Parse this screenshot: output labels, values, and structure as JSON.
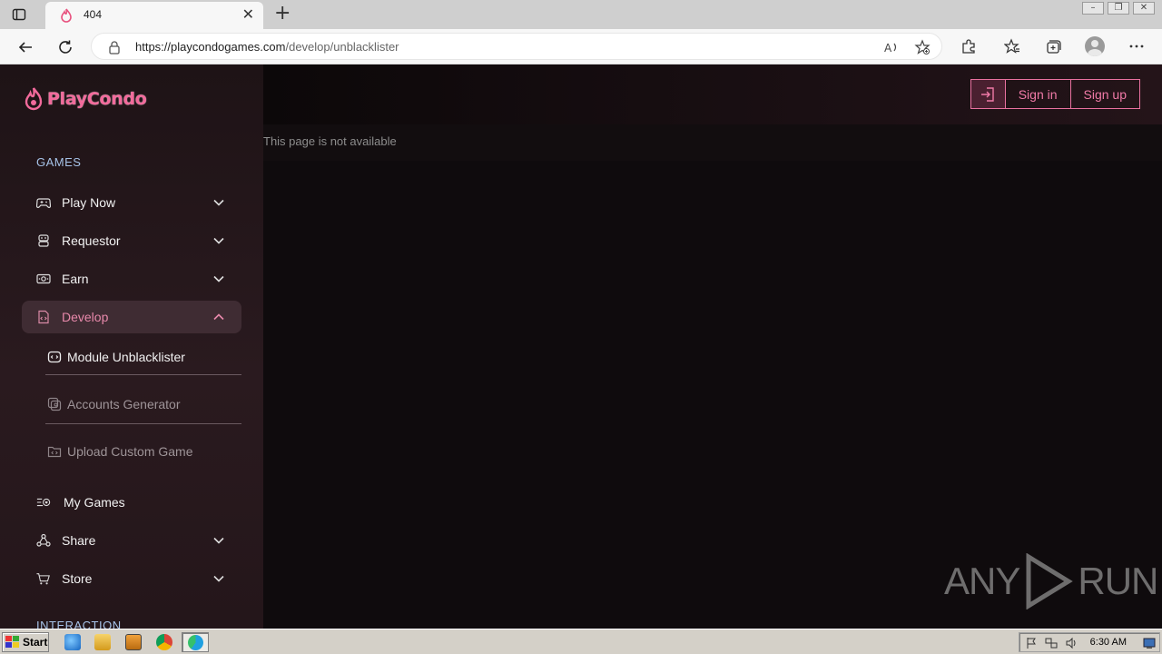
{
  "browser": {
    "tab_title": "404",
    "url_host": "https://playcondogames.com",
    "url_path": "/develop/unblacklister"
  },
  "brand": {
    "name": "PlayCondo",
    "accent": "#f26a9b"
  },
  "sidebar": {
    "section_games": "GAMES",
    "items": [
      {
        "label": "Play Now",
        "icon": "gamepad-icon"
      },
      {
        "label": "Requestor",
        "icon": "robot-icon"
      },
      {
        "label": "Earn",
        "icon": "money-icon"
      },
      {
        "label": "Develop",
        "icon": "file-code-icon"
      }
    ],
    "develop_sub": [
      {
        "label": "Module Unblacklister",
        "icon": "module-icon"
      },
      {
        "label": "Accounts Generator",
        "icon": "accounts-icon"
      },
      {
        "label": "Upload Custom Game",
        "icon": "upload-folder-icon"
      }
    ],
    "items_after": [
      {
        "label": "My Games",
        "icon": "list-heart-icon"
      },
      {
        "label": "Share",
        "icon": "share-icon"
      },
      {
        "label": "Store",
        "icon": "cart-icon"
      }
    ],
    "section_interaction": "INTERACTION"
  },
  "header": {
    "sign_in": "Sign in",
    "sign_up": "Sign up"
  },
  "main": {
    "notice": "This page is not available"
  },
  "watermark": {
    "text": "ANY",
    "text2": "RUN"
  },
  "taskbar": {
    "start": "Start",
    "clock": "6:30 AM"
  }
}
